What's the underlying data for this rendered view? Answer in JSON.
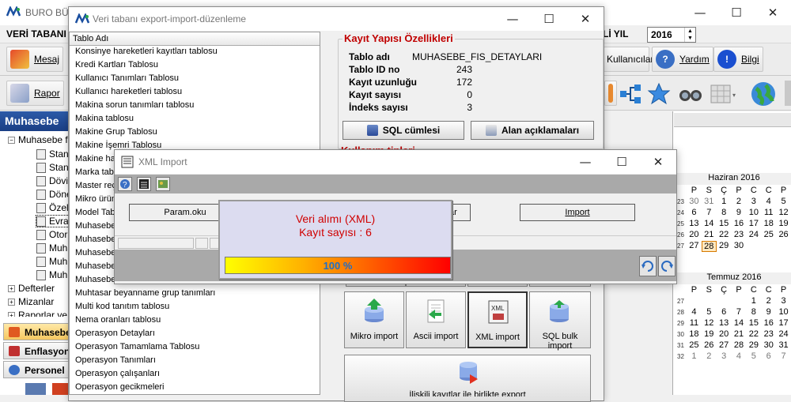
{
  "main_window": {
    "title": "BURO BÜR",
    "controls": {
      "minimize": "—",
      "maximize": "☐",
      "close": "✕"
    },
    "menu_left": "VERİ TABANI",
    "menu_right": "Lİ YIL",
    "year": "2016",
    "toolbar1": {
      "mesaj": "Mesaj",
      "kullanicilar": "Kullanıcılar",
      "yardim": "Yardım",
      "bilgi": "Bilgi"
    },
    "toolbar2": {
      "rapor": "Rapor"
    }
  },
  "left_panel": {
    "header": "Muhasebe",
    "tree_root": "Muhasebe fi",
    "sub_items": [
      "Stan",
      "Stan",
      "Dövi",
      "Döne",
      "Özel",
      "Evra",
      "Otor",
      "Muha",
      "Muh",
      "Muh"
    ],
    "groups": [
      "Defterler",
      "Mizanlar",
      "Raporlar ve"
    ],
    "tabs": [
      "Muhasebe",
      "Enflasyon",
      "Personel"
    ]
  },
  "calendar": {
    "june": {
      "title": "Haziran 2016",
      "days": [
        "P",
        "S",
        "Ç",
        "P",
        "C",
        "C",
        "P"
      ],
      "rows": [
        {
          "wk": "23",
          "d": [
            "30",
            "31",
            "1",
            "2",
            "3",
            "4",
            "5"
          ]
        },
        {
          "wk": "24",
          "d": [
            "6",
            "7",
            "8",
            "9",
            "10",
            "11",
            "12"
          ]
        },
        {
          "wk": "25",
          "d": [
            "13",
            "14",
            "15",
            "16",
            "17",
            "18",
            "19"
          ]
        },
        {
          "wk": "26",
          "d": [
            "20",
            "21",
            "22",
            "23",
            "24",
            "25",
            "26"
          ]
        },
        {
          "wk": "27",
          "d": [
            "27",
            "28",
            "29",
            "30",
            "",
            "",
            ""
          ]
        }
      ],
      "today": "28"
    },
    "july": {
      "title": "Temmuz 2016",
      "days": [
        "P",
        "S",
        "Ç",
        "P",
        "C",
        "C",
        "P"
      ],
      "rows": [
        {
          "wk": "27",
          "d": [
            "",
            "",
            "",
            "",
            "1",
            "2",
            "3"
          ]
        },
        {
          "wk": "28",
          "d": [
            "4",
            "5",
            "6",
            "7",
            "8",
            "9",
            "10"
          ]
        },
        {
          "wk": "29",
          "d": [
            "11",
            "12",
            "13",
            "14",
            "15",
            "16",
            "17"
          ]
        },
        {
          "wk": "30",
          "d": [
            "18",
            "19",
            "20",
            "21",
            "22",
            "23",
            "24"
          ]
        },
        {
          "wk": "31",
          "d": [
            "25",
            "26",
            "27",
            "28",
            "29",
            "30",
            "31"
          ]
        },
        {
          "wk": "32",
          "d": [
            "1",
            "2",
            "3",
            "4",
            "5",
            "6",
            "7"
          ]
        }
      ]
    }
  },
  "db_dialog": {
    "title": "Veri tabanı export-import-düzenleme",
    "controls": {
      "minimize": "—",
      "maximize": "☐",
      "close": "✕"
    },
    "table_header": "Tablo Adı",
    "tables": [
      "Konsinye hareketleri kayıtları tablosu",
      "Kredi Kartları Tablosu",
      "Kullanıcı Tanımları Tablosu",
      "Kullanıcı hareketleri tablosu",
      "Makina sorun tanımları tablosu",
      "Makina tablosu",
      "Makine Grup Tablosu",
      "Makine İşemri Tablosu",
      "Makine ha",
      "Marka tab",
      "Master reç",
      "Mikro ürün",
      "Model Tab",
      "Muhasebe",
      "Muhasebe",
      "Muhasebe",
      "Muhasebe",
      "Muhasebe hesap planı tablosu",
      "Muhtasar beyanname grup tanımları",
      "Multi kod tanıtım tablosu",
      "Nema oranları tablosu",
      "Operasyon Detayları",
      "Operasyon Tamamlama Tablosu",
      "Operasyon Tanımları",
      "Operasyon çalışanları",
      "Operasyon gecikmeleri"
    ],
    "props_title": "Kayıt Yapısı Özellikleri",
    "props": [
      {
        "label": "Tablo adı",
        "value": "MUHASEBE_FIS_DETAYLARI"
      },
      {
        "label": "Tablo ID no",
        "value": "243"
      },
      {
        "label": "Kayıt uzunluğu",
        "value": "172"
      },
      {
        "label": "Kayıt sayısı",
        "value": "0"
      },
      {
        "label": "İndeks sayısı",
        "value": "3"
      }
    ],
    "sql_button": "SQL cümlesi",
    "fields_button": "Alan açıklamaları",
    "hidden_red_heading": "Kullanım tipleri",
    "import_buttons": [
      "Mikro import",
      "Ascii import",
      "XML import",
      "SQL bulk import"
    ],
    "bottom_button": "İlişkili kayıtlar ile birlikte export"
  },
  "xml_dialog": {
    "title": "XML Import",
    "controls": {
      "minimize": "—",
      "maximize": "☐",
      "close": "✕"
    },
    "param_button": "Param.oku",
    "hidden_button_fragment": "ar",
    "import_button": "Import"
  },
  "progress_popup": {
    "line1": "Veri alımı (XML)",
    "line2": "Kayıt sayısı : 6",
    "percent_text": "100 %",
    "progress": 1.0
  }
}
